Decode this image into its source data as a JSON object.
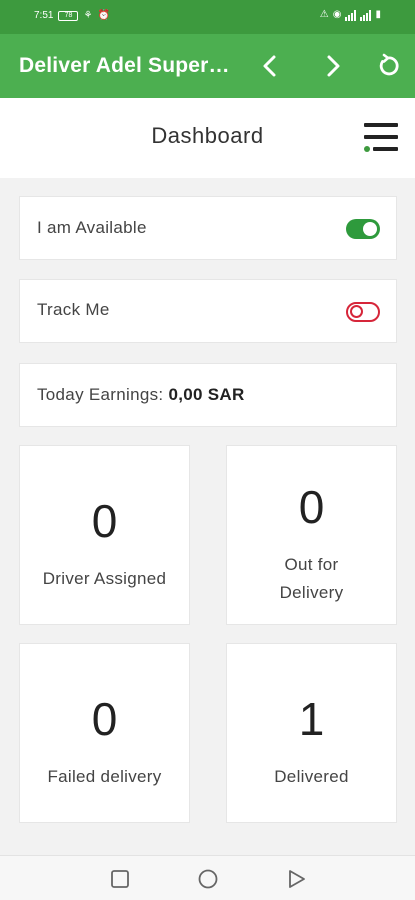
{
  "status_bar": {
    "time": "7:51",
    "battery": "78",
    "icons_left": [
      "battery-saver-icon",
      "usb-icon",
      "alarm-icon"
    ],
    "icons_right": [
      "warning-icon",
      "hotspot-icon",
      "signal-icon",
      "signal-icon"
    ]
  },
  "app_bar": {
    "title": "Deliver Adel Super…",
    "back_icon": "chevron-left-icon",
    "forward_icon": "chevron-right-icon",
    "refresh_icon": "refresh-icon",
    "bg_color": "#4caf50"
  },
  "header": {
    "title": "Dashboard",
    "menu_icon": "menu-icon"
  },
  "available": {
    "label": "I am Available",
    "enabled": true,
    "color": "#2e9a3c"
  },
  "track": {
    "label": "Track Me",
    "enabled": false,
    "color": "#d6263a"
  },
  "earnings": {
    "label": "Today Earnings:",
    "value": "0,00 SAR"
  },
  "stats": [
    {
      "count": "0",
      "label_line1": "Driver Assigned",
      "label_line2": ""
    },
    {
      "count": "0",
      "label_line1": "Out for",
      "label_line2": "Delivery"
    },
    {
      "count": "0",
      "label_line1": "Failed delivery",
      "label_line2": ""
    },
    {
      "count": "1",
      "label_line1": "Delivered",
      "label_line2": ""
    }
  ],
  "nav_bar": {
    "recents_icon": "square-icon",
    "home_icon": "circle-icon",
    "back_icon": "triangle-icon"
  }
}
